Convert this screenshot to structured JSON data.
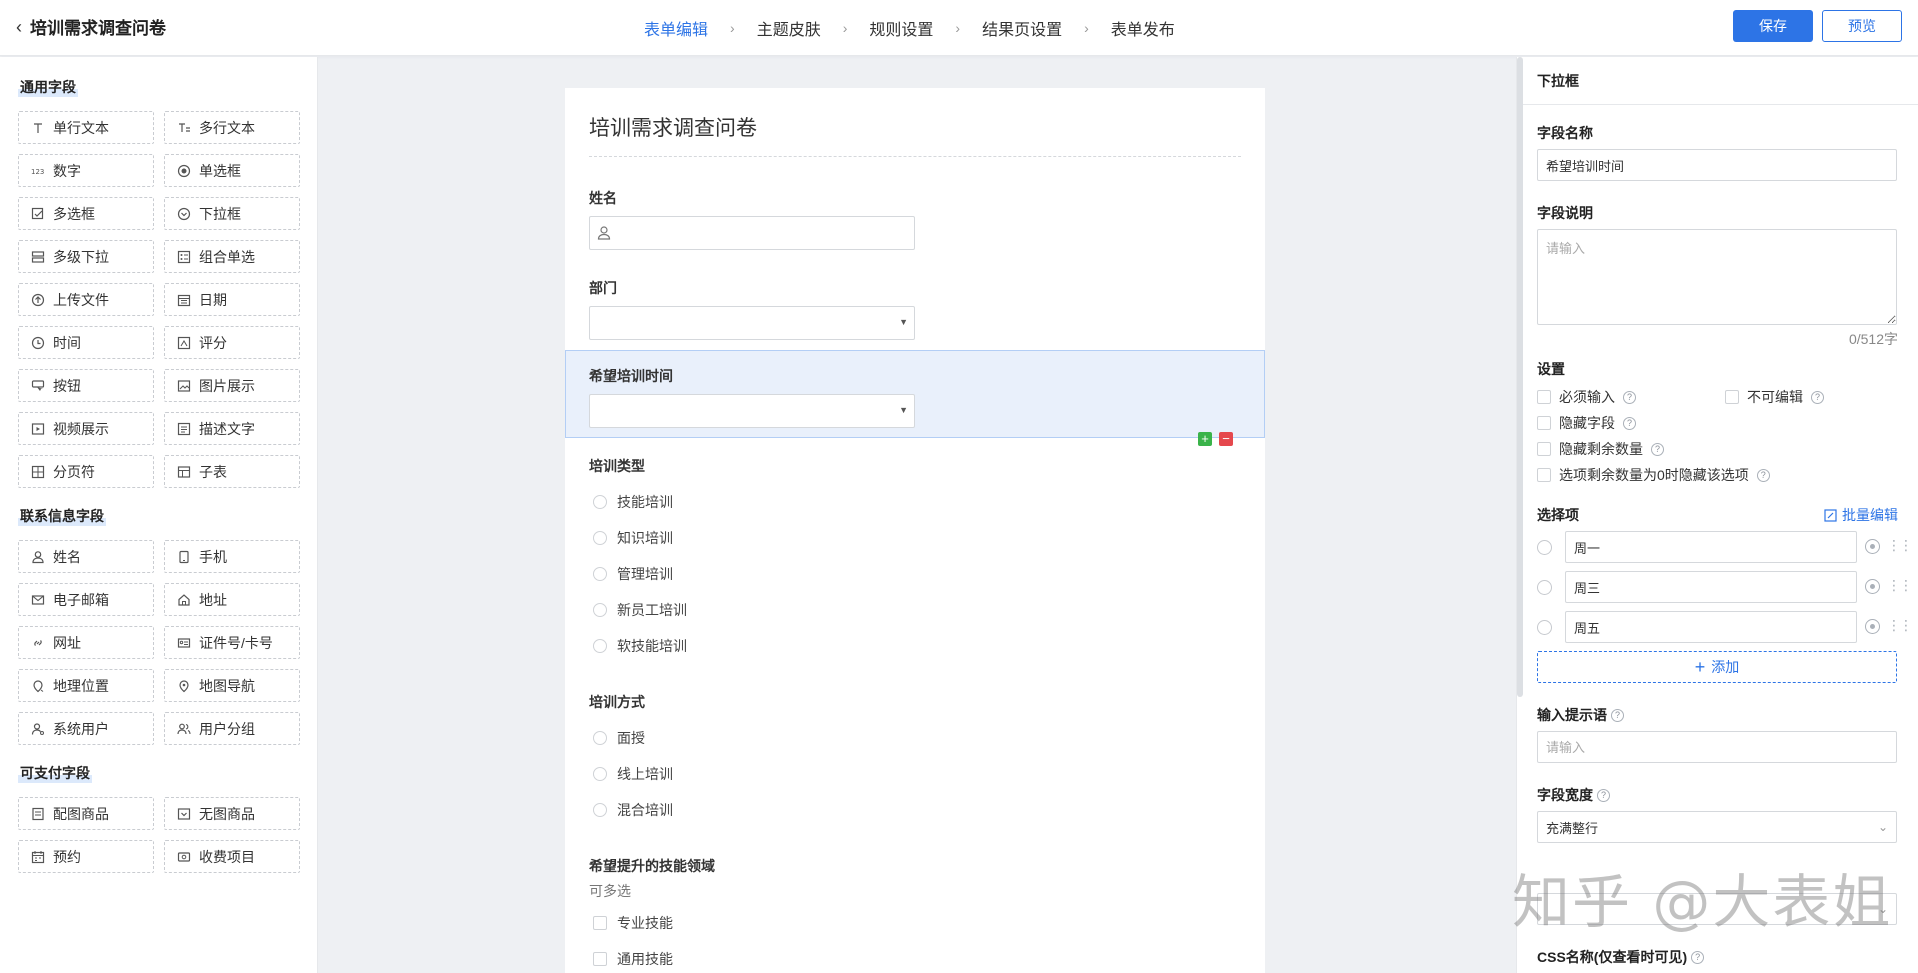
{
  "header": {
    "back_title": "培训需求调查问卷",
    "steps": [
      "表单编辑",
      "主题皮肤",
      "规则设置",
      "结果页设置",
      "表单发布"
    ],
    "save": "保存",
    "preview": "预览"
  },
  "palette": {
    "groups": [
      {
        "title": "通用字段",
        "items": [
          {
            "label": "单行文本",
            "icon": "text-line-icon"
          },
          {
            "label": "多行文本",
            "icon": "text-multiline-icon"
          },
          {
            "label": "数字",
            "icon": "number-icon"
          },
          {
            "label": "单选框",
            "icon": "radio-icon"
          },
          {
            "label": "多选框",
            "icon": "checkbox-icon"
          },
          {
            "label": "下拉框",
            "icon": "dropdown-icon"
          },
          {
            "label": "多级下拉",
            "icon": "cascade-icon"
          },
          {
            "label": "组合单选",
            "icon": "group-radio-icon"
          },
          {
            "label": "上传文件",
            "icon": "upload-icon"
          },
          {
            "label": "日期",
            "icon": "calendar-icon"
          },
          {
            "label": "时间",
            "icon": "clock-icon"
          },
          {
            "label": "评分",
            "icon": "rating-icon"
          },
          {
            "label": "按钮",
            "icon": "button-icon"
          },
          {
            "label": "图片展示",
            "icon": "image-icon"
          },
          {
            "label": "视频展示",
            "icon": "video-icon"
          },
          {
            "label": "描述文字",
            "icon": "description-icon"
          },
          {
            "label": "分页符",
            "icon": "pagebreak-icon"
          },
          {
            "label": "子表",
            "icon": "table-icon"
          }
        ]
      },
      {
        "title": "联系信息字段",
        "items": [
          {
            "label": "姓名",
            "icon": "user-icon"
          },
          {
            "label": "手机",
            "icon": "phone-icon"
          },
          {
            "label": "电子邮箱",
            "icon": "mail-icon"
          },
          {
            "label": "地址",
            "icon": "home-icon"
          },
          {
            "label": "网址",
            "icon": "link-icon"
          },
          {
            "label": "证件号/卡号",
            "icon": "id-card-icon"
          },
          {
            "label": "地理位置",
            "icon": "location-icon"
          },
          {
            "label": "地图导航",
            "icon": "map-pin-icon"
          },
          {
            "label": "系统用户",
            "icon": "system-user-icon"
          },
          {
            "label": "用户分组",
            "icon": "user-group-icon"
          }
        ]
      },
      {
        "title": "可支付字段",
        "items": [
          {
            "label": "配图商品",
            "icon": "product-image-icon"
          },
          {
            "label": "无图商品",
            "icon": "product-icon"
          },
          {
            "label": "预约",
            "icon": "booking-icon"
          },
          {
            "label": "收费项目",
            "icon": "charge-icon"
          }
        ]
      }
    ]
  },
  "form": {
    "title": "培训需求调查问卷",
    "q_name": "姓名",
    "q_dept": "部门",
    "q_time": "希望培训时间",
    "q_type": "培训类型",
    "type_options": [
      "技能培训",
      "知识培训",
      "管理培训",
      "新员工培训",
      "软技能培训"
    ],
    "q_mode": "培训方式",
    "mode_options": [
      "面授",
      "线上培训",
      "混合培训"
    ],
    "q_skill": "希望提升的技能领域",
    "skill_hint": "可多选",
    "skill_options": [
      "专业技能",
      "通用技能"
    ]
  },
  "props": {
    "header": "下拉框",
    "field_name_label": "字段名称",
    "field_name_value": "希望培训时间",
    "field_desc_label": "字段说明",
    "field_desc_placeholder": "请输入",
    "counter": "0/512字",
    "settings_label": "设置",
    "required": "必须输入",
    "readonly": "不可编辑",
    "hidden": "隐藏字段",
    "hide_remaining": "隐藏剩余数量",
    "hide_zero": "选项剩余数量为0时隐藏该选项",
    "options_label": "选择项",
    "batch_edit": "批量编辑",
    "options": [
      "周一",
      "周三",
      "周五"
    ],
    "add": "添加",
    "prompt_label": "输入提示语",
    "prompt_placeholder": "请输入",
    "width_label": "字段宽度",
    "width_value": "充满整行",
    "css_label": "CSS名称(仅查看时可见)"
  },
  "watermark": "知乎 @大表姐",
  "colors": {
    "accent": "#2d74e6",
    "selected_bg": "#e9f0fb",
    "add_green": "#3ab34a",
    "delete_red": "#e5484d"
  }
}
